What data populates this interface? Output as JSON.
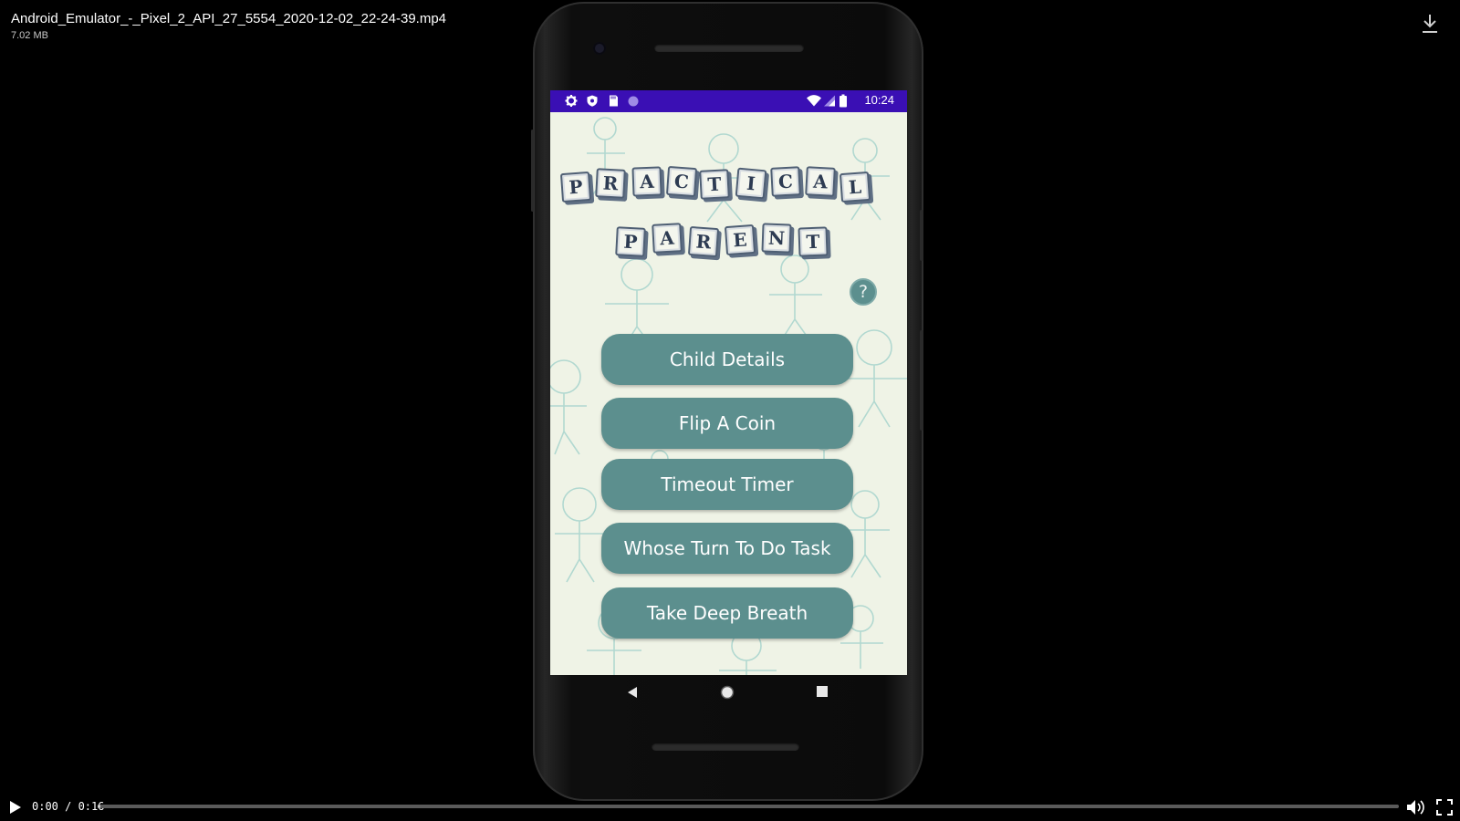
{
  "file": {
    "name": "Android_Emulator_-_Pixel_2_API_27_5554_2020-12-02_22-24-39.mp4",
    "size": "7.02 MB"
  },
  "icons": {
    "download": "download-icon",
    "play": "play-icon",
    "volume": "volume-icon",
    "fullscreen": "fullscreen-icon"
  },
  "status_bar": {
    "time": "10:24",
    "left_icons": [
      "settings-icon",
      "shield-icon",
      "sd-card-icon",
      "circle-icon"
    ],
    "right_icons": [
      "wifi-icon",
      "signal-icon",
      "battery-icon"
    ],
    "color": "#3a0fb4"
  },
  "app": {
    "logo_rows": [
      [
        "P",
        "R",
        "A",
        "C",
        "T",
        "I",
        "C",
        "A",
        "L"
      ],
      [
        "P",
        "A",
        "R",
        "E",
        "N",
        "T"
      ]
    ],
    "help_label": "?",
    "buttons": [
      "Child Details",
      "Flip A Coin",
      "Timeout Timer",
      "Whose Turn To Do Task",
      "Take Deep Breath"
    ],
    "button_color": "#5c8f8e",
    "background_color": "#eff3e6"
  },
  "nav_bar": [
    "back-icon",
    "home-icon",
    "recents-icon"
  ],
  "video": {
    "time": "0:00 / 0:16",
    "progress": 0.0
  }
}
